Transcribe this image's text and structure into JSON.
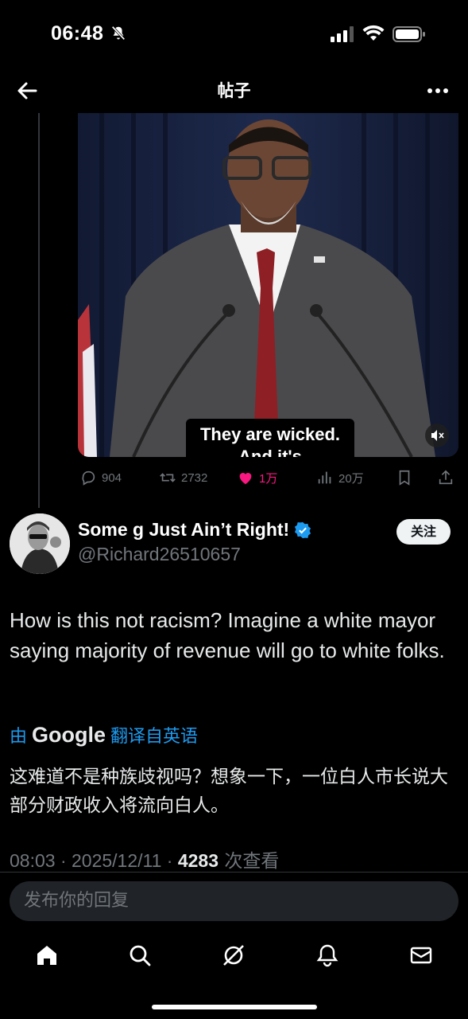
{
  "status_bar": {
    "time": "06:48"
  },
  "header": {
    "title": "帖子"
  },
  "video": {
    "caption_line1": "They are wicked.",
    "caption_line2": "And it's"
  },
  "quoted_actions": {
    "replies": "904",
    "reposts": "2732",
    "likes": "1万",
    "views": "20万"
  },
  "tweet": {
    "author_name": "Some     g Just Ain’t Right!",
    "handle": "@Richard26510657",
    "follow_label": "关注",
    "text": "How is this not racism?  Imagine a white mayor saying majority of revenue will go to white folks.",
    "translate_prefix": "由",
    "translate_brand": "Google",
    "translate_suffix": "翻译自英语",
    "translated_text": "这难道不是种族歧视吗？想象一下，一位白人市长说大部分财政收入将流向白人。",
    "time": "08:03 · 2025/12/11 · ",
    "view_count": "4283",
    "view_label": " 次查看"
  },
  "reply_box": {
    "placeholder": "发布你的回复"
  },
  "colors": {
    "background": "#000000",
    "accent": "#1d9bf0",
    "like": "#f91880",
    "muted": "#71767b"
  },
  "icons": [
    "bell-slash-icon",
    "signal-icon",
    "wifi-icon",
    "battery-icon",
    "back-arrow-icon",
    "more-icon",
    "mute-icon",
    "reply-icon",
    "repost-icon",
    "heart-icon",
    "views-icon",
    "bookmark-icon",
    "share-icon",
    "verified-icon",
    "home-icon",
    "search-icon",
    "grok-icon",
    "notifications-icon",
    "messages-icon"
  ]
}
